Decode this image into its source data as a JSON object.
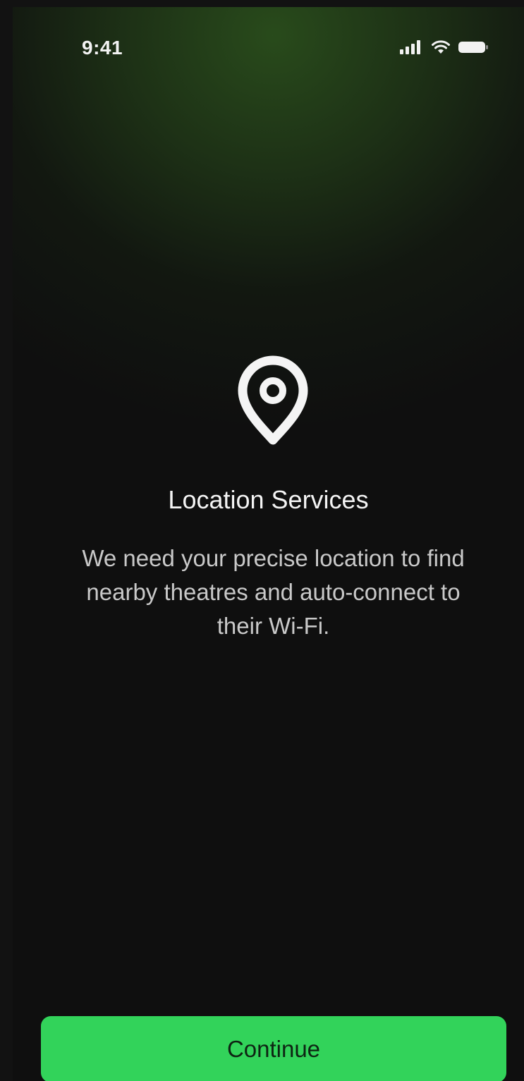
{
  "status_bar": {
    "time": "9:41",
    "icons": [
      "cellular-signal-icon",
      "wifi-icon",
      "battery-icon"
    ]
  },
  "main": {
    "icon": "location-pin-icon",
    "title": "Location Services",
    "description": "We need your precise location to find nearby theatres and auto-connect to their Wi-Fi."
  },
  "actions": {
    "continue_label": "Continue"
  },
  "colors": {
    "background": "#0f0f0f",
    "accent": "#32d35a",
    "glow": "#2a4e1c",
    "text_primary": "#f4f4f4",
    "text_secondary": "#c9c9c9"
  }
}
